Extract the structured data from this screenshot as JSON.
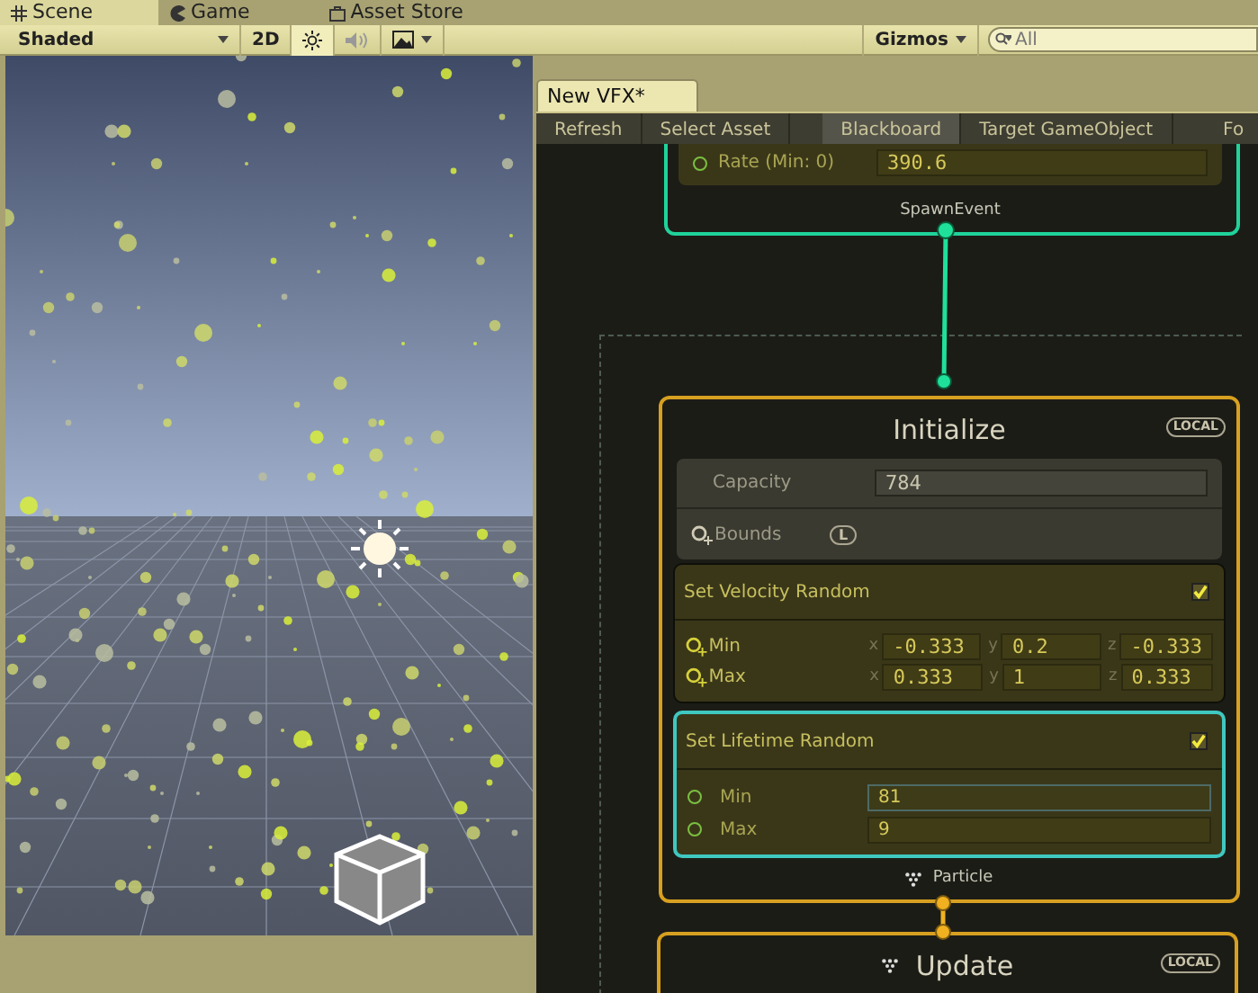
{
  "editor_tabs": [
    {
      "label": "Scene",
      "selected": true,
      "kind": "grid"
    },
    {
      "label": "Game",
      "selected": false,
      "kind": "pacman"
    },
    {
      "label": "Asset Store",
      "selected": false,
      "kind": "bag"
    }
  ],
  "scene_toolbar": {
    "shading": "Shaded",
    "mode_2d": "2D",
    "lighting_on": true,
    "audio_on": false,
    "gizmos": "Gizmos",
    "search_placeholder": "All"
  },
  "vfx_window": {
    "title": "New VFX*",
    "toolbar": [
      {
        "label": "Refresh",
        "selected": false
      },
      {
        "label": "Select Asset",
        "selected": false
      },
      {
        "label": "Blackboard",
        "selected": true
      },
      {
        "label": "Target GameObject",
        "selected": false
      },
      {
        "label": "Fo",
        "selected": false
      }
    ],
    "spawn_context": {
      "rate_label": "Rate (Min: 0)",
      "rate_value": "390.6",
      "output": "SpawnEvent"
    },
    "initialize": {
      "title": "Initialize",
      "space": "LOCAL",
      "capacity_label": "Capacity",
      "capacity_value": "784",
      "bounds_label": "Bounds",
      "bounds_space": "L",
      "blocks": [
        {
          "kind": "vector3",
          "title": "Set Velocity Random",
          "enabled": true,
          "selected": false,
          "fields": [
            {
              "label": "Min",
              "components": [
                {
                  "axis": "x",
                  "value": "-0.333"
                },
                {
                  "axis": "y",
                  "value": "0.2"
                },
                {
                  "axis": "z",
                  "value": "-0.333"
                }
              ]
            },
            {
              "label": "Max",
              "components": [
                {
                  "axis": "x",
                  "value": "0.333"
                },
                {
                  "axis": "y",
                  "value": "1"
                },
                {
                  "axis": "z",
                  "value": "0.333"
                }
              ]
            }
          ]
        },
        {
          "kind": "float",
          "title": "Set Lifetime Random",
          "enabled": true,
          "selected": true,
          "fields": [
            {
              "label": "Min",
              "value": "81",
              "focused": true
            },
            {
              "label": "Max",
              "value": "9",
              "focused": false
            }
          ]
        }
      ],
      "output": "Particle"
    },
    "update": {
      "title": "Update",
      "space": "LOCAL"
    }
  }
}
